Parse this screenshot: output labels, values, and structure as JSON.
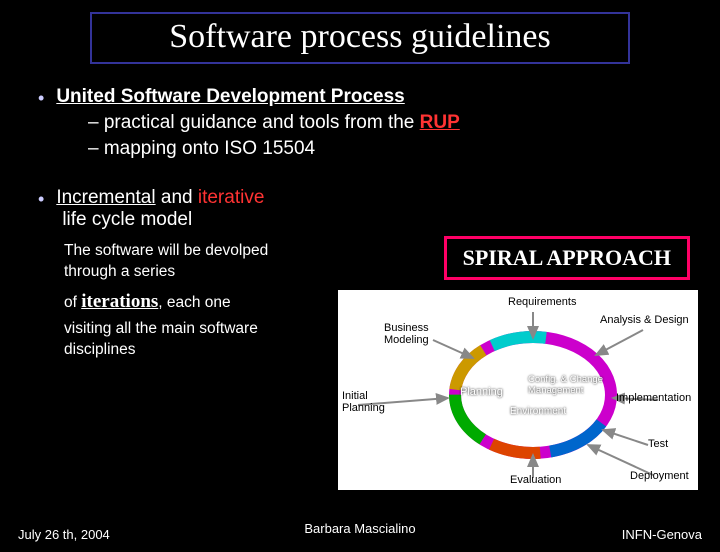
{
  "title": "Software process guidelines",
  "bullet1": {
    "label": "United Software Development Process",
    "sub1_a": "–  practical guidance and tools from the ",
    "sub1_rup": "RUP",
    "sub2": "–  mapping onto ISO 15504"
  },
  "bullet2": {
    "line_a": "Incremental",
    "line_b": " and ",
    "line_c": "iterative",
    "line2": "life cycle model"
  },
  "spiral": "SPIRAL APPROACH",
  "desc": {
    "d1": "The software will be devolped through a series",
    "d2_a": "of ",
    "d2_b": "iterations",
    "d2_c": ", each one",
    "d3": "visiting all the main software disciplines"
  },
  "diagram": {
    "req": "Requirements",
    "biz": "Business Modeling",
    "ad": "Analysis & Design",
    "plan": "Planning",
    "conf": "Config. & Change Management",
    "impl": "Implementation",
    "init": "Initial Planning",
    "env": "Environment",
    "test": "Test",
    "eval": "Evaluation",
    "dep": "Deployment"
  },
  "footer": {
    "left": "July 26 th, 2004",
    "center": "Barbara Mascialino",
    "right": "INFN-Genova"
  }
}
